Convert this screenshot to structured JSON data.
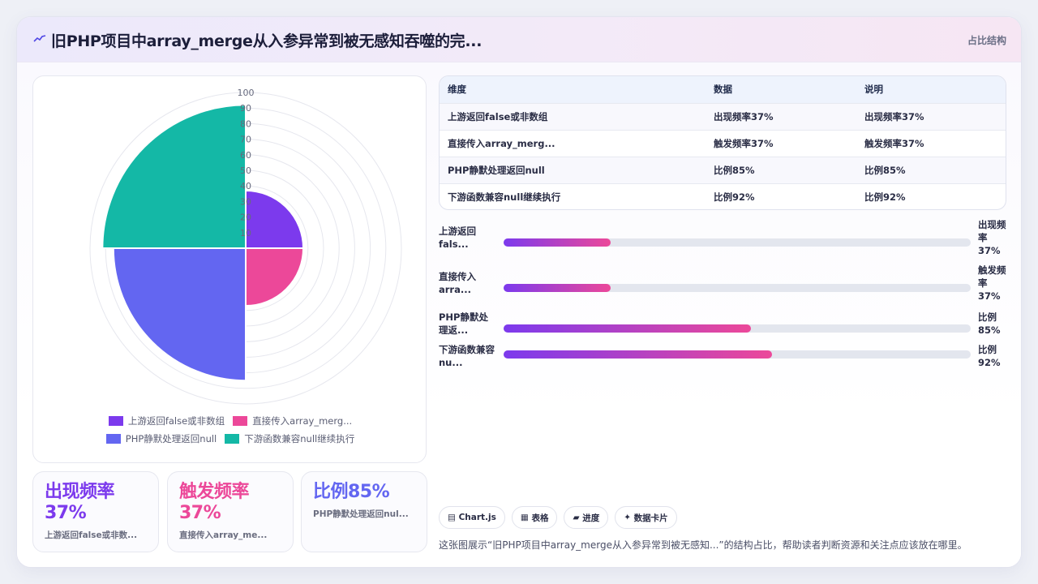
{
  "header": {
    "icon": "line-chart-icon",
    "title": "旧PHP项目中array_merge从入参异常到被无感知吞噬的完...",
    "tag": "占比结构"
  },
  "chart_data": {
    "type": "polarArea",
    "r_axis": {
      "min": 0,
      "max": 100,
      "ticks": [
        "100",
        "90",
        "80",
        "70",
        "60",
        "50",
        "40",
        "30",
        "20",
        "10"
      ]
    },
    "categories": [
      "上游返回false或非数组",
      "直接传入array_merg...",
      "PHP静默处理返回null",
      "下游函数兼容null继续执行"
    ],
    "values": [
      37,
      37,
      85,
      92
    ],
    "colors": [
      "#7c3aed",
      "#ec4899",
      "#6366f1",
      "#14b8a6"
    ],
    "legend": [
      {
        "label": "上游返回false或非数组",
        "color": "#7c3aed"
      },
      {
        "label": "直接传入array_merg...",
        "color": "#ec4899"
      },
      {
        "label": "PHP静默处理返回null",
        "color": "#6366f1"
      },
      {
        "label": "下游函数兼容null继续执行",
        "color": "#14b8a6"
      }
    ]
  },
  "stats": [
    {
      "value": "出现频率\n37%",
      "caption": "上游返回false或非数...",
      "color": "#7c3aed"
    },
    {
      "value": "触发频率\n37%",
      "caption": "直接传入array_me...",
      "color": "#ec4899"
    },
    {
      "value": "比例85%",
      "caption": "PHP静默处理返回nul...",
      "color": "#6366f1"
    }
  ],
  "table": {
    "headers": [
      "维度",
      "数据",
      "说明"
    ],
    "rows": [
      [
        "上游返回false或非数组",
        "出现频率37%",
        "出现频率37%"
      ],
      [
        "直接传入array_merg...",
        "触发频率37%",
        "触发频率37%"
      ],
      [
        "PHP静默处理返回null",
        "比例85%",
        "比例85%"
      ],
      [
        "下游函数兼容null继续执行",
        "比例92%",
        "比例92%"
      ]
    ]
  },
  "progress": [
    {
      "label": "上游返回\nfals...",
      "value": "出现频\n率\n37%",
      "fraction": 0.23
    },
    {
      "label": "直接传入\narra...",
      "value": "触发频\n率\n37%",
      "fraction": 0.23
    },
    {
      "label": "PHP静默处\n理返...",
      "value": "比例\n85%",
      "fraction": 0.53
    },
    {
      "label": "下游函数兼容\nnu...",
      "value": "比例\n92%",
      "fraction": 0.575
    }
  ],
  "pills": [
    {
      "icon": "▤",
      "label": "Chart.js"
    },
    {
      "icon": "▦",
      "label": "表格"
    },
    {
      "icon": "▰",
      "label": "进度"
    },
    {
      "icon": "✦",
      "label": "数据卡片"
    }
  ],
  "caption": "这张图展示“旧PHP项目中array_merge从入参异常到被无感知...”的结构占比，帮助读者判断资源和关注点应该放在哪里。"
}
